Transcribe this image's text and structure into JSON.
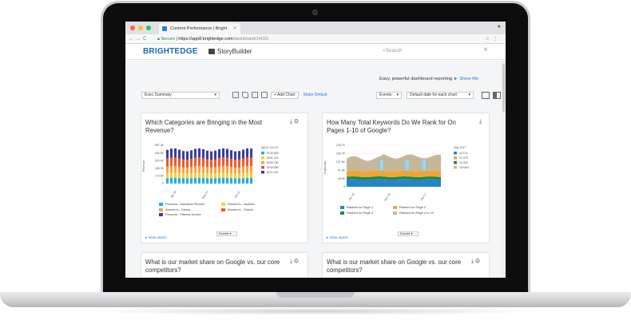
{
  "browser": {
    "tab_title": "Content Performance | Bright",
    "tab_close": "×",
    "url_secure": "Secure",
    "url_host": "https://app8.brightedge.com",
    "url_path": "/dashboard/14029"
  },
  "app": {
    "logo": "BRIGHTEDGE",
    "product": "StoryBuilder",
    "search_placeholder": "Search",
    "search_close": "×"
  },
  "promo": {
    "text": "Easy, powerful dashboard reporting",
    "link": "► Show Me"
  },
  "toolbar": {
    "dashboard_select": "Exec Summary",
    "add_chart": "+ Add Chart",
    "make_default": "Make Default",
    "events_select": "Events",
    "date_select": "Default date for each chart"
  },
  "cards": [
    {
      "title": "Which Categories are Bringing in the Most Revenue?",
      "view_report": "▸ View report",
      "events": "Events",
      "chart_data": {
        "type": "bar",
        "ylabel": "Revenue",
        "y_ticks": [
          "887.3K",
          "690.8K",
          "520.4K",
          "346.9K",
          "173.5K",
          "0"
        ],
        "x_ticks": [
          "Apr 22",
          "May 27",
          "Jun 11"
        ],
        "legend_title": "WA of Jun 18",
        "legend_values": [
          "$130,890",
          "$161,024",
          "$189,780",
          "$230,850",
          "$211,240"
        ],
        "bar_count": 22,
        "series": [
          {
            "name": "Persona - Marathon Runner",
            "color": "#18b3e6",
            "share": 0.16
          },
          {
            "name": "Women's - Jackets",
            "color": "#f4d133",
            "share": 0.15
          },
          {
            "name": "Women's - Shoes",
            "color": "#f5a24a",
            "share": 0.19
          },
          {
            "name": "Women's - Shorts",
            "color": "#f05a28",
            "share": 0.24
          },
          {
            "name": "Persona - Fitness Novice",
            "color": "#3b3f9e",
            "share": 0.26
          }
        ],
        "series_legend": [
          "Persona - Marathon Runner",
          "Women's - Jackets",
          "Women's - Shoes",
          "Women's - Shorts",
          "Persona - Fitness Novice"
        ]
      }
    },
    {
      "title": "How Many Total Keywords Do We Rank for On Pages 1-10 of Google?",
      "view_report": "▸ View report",
      "events": "Events",
      "chart_data": {
        "type": "area",
        "ylabel": "Keywords",
        "y_ticks": [
          "228.7K",
          "183.7K",
          "137.8K",
          "91.8K",
          "45.9K",
          "0"
        ],
        "x_ticks": [
          "Jan 16",
          "Nov 16",
          "Jan 17"
        ],
        "legend_title": "May 2017",
        "legend_values": [
          "42,121",
          "21,078",
          "10,302",
          "116,861"
        ],
        "series": [
          {
            "name": "Ranked on Page 1",
            "color": "#2585c7"
          },
          {
            "name": "Ranked on Page 2",
            "color": "#f0a535"
          },
          {
            "name": "Ranked on Page 3",
            "color": "#1e8a4c"
          },
          {
            "name": "Ranked on Page 4 to 10",
            "color": "#c7b79a"
          }
        ]
      }
    },
    {
      "title": "What is our market share on Google vs. our core competitors?"
    },
    {
      "title": "What is our market share on Google vs. our core competitors?"
    }
  ],
  "colors": {
    "brand": "#1769b7",
    "link": "#2a7de1"
  }
}
